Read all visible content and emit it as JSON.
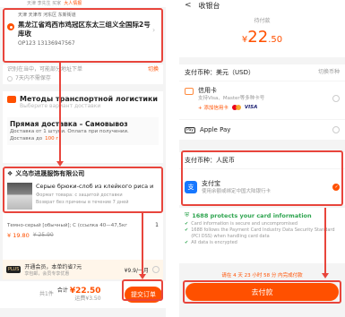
{
  "left": {
    "top_bar": {
      "nickname": "天津 李先生 买家",
      "badge": "大人情报"
    },
    "address": {
      "tags": "天津 天津市 河东区 东新街道",
      "line": "黑龙江省鸡西市鸡冠区东太三组义全国际2号库收",
      "contact": "OP123 13136947567"
    },
    "notice": {
      "text": "识别在当中，可能部分地址下单",
      "action": "切换"
    },
    "notice2": "7天内不需保存",
    "logistics": {
      "title": "Методы транспортной логистики",
      "sub": "Выберите вариант доставки"
    },
    "delivery": {
      "title": "Прямая доставка – Самовывоз",
      "line1": "Доставка от 1 штуки. Оплата при получении.",
      "line2": "Доставка до",
      "price": "100 г"
    },
    "shop": {
      "name": "义乌市进晟服饰有限公司"
    },
    "product": {
      "title": "Серые брюки-слоб из клейкого риса и",
      "attr1": "Формат товара: с защитой доставки",
      "attr2": "Возврат без причины в течение 7 дней",
      "spec": "Темно-серый [обычный]; С (ссылка 40—47,5кг",
      "qty": "1",
      "price": "¥ 19.80",
      "orig": "¥ 25.90"
    },
    "plus": {
      "badge": "PLUS",
      "line1": "开通会员，本单约省7元",
      "line2": "享包邮，会员专享优惠",
      "price": "¥9.9/一月"
    },
    "footer": {
      "count": "共1件",
      "total_label": "合计",
      "total": "¥22.50",
      "shipping": "运费¥3.50",
      "submit": "提交订单"
    }
  },
  "right": {
    "header": {
      "back": "<",
      "title": "收银台"
    },
    "amount": {
      "label": "待付款",
      "currency": "¥",
      "integer": "22",
      "decimal": ".50"
    },
    "currency_usd": {
      "label": "支付币种：美元（USD）",
      "switch": "切换币种"
    },
    "card": {
      "name": "信用卡",
      "desc": "支持Visa、Master等多种卡号",
      "add": "+ 添加信用卡",
      "visa": "VISA"
    },
    "applepay": {
      "icon": "Pay",
      "name": "Apple Pay"
    },
    "currency_rmb": {
      "label": "支付币种：人民币"
    },
    "alipay": {
      "icon": "支",
      "name": "支付宝",
      "desc": "使用余额或绑定中国大陆银行卡"
    },
    "security": {
      "title": "1688 protects your card information",
      "items": [
        "Card information is secure and uncompromised",
        "1688 follows the Payment Card Industry Data Security Standard (PCI DSS) when handling card data",
        "All data is encrypted"
      ]
    },
    "countdown": "请在 4 天 23 小时 58 分 内完成付款",
    "pay_button": "去付款"
  },
  "colors": {
    "accent": "#ff5000",
    "highlight": "#e8453c",
    "alipay": "#1677ff"
  }
}
